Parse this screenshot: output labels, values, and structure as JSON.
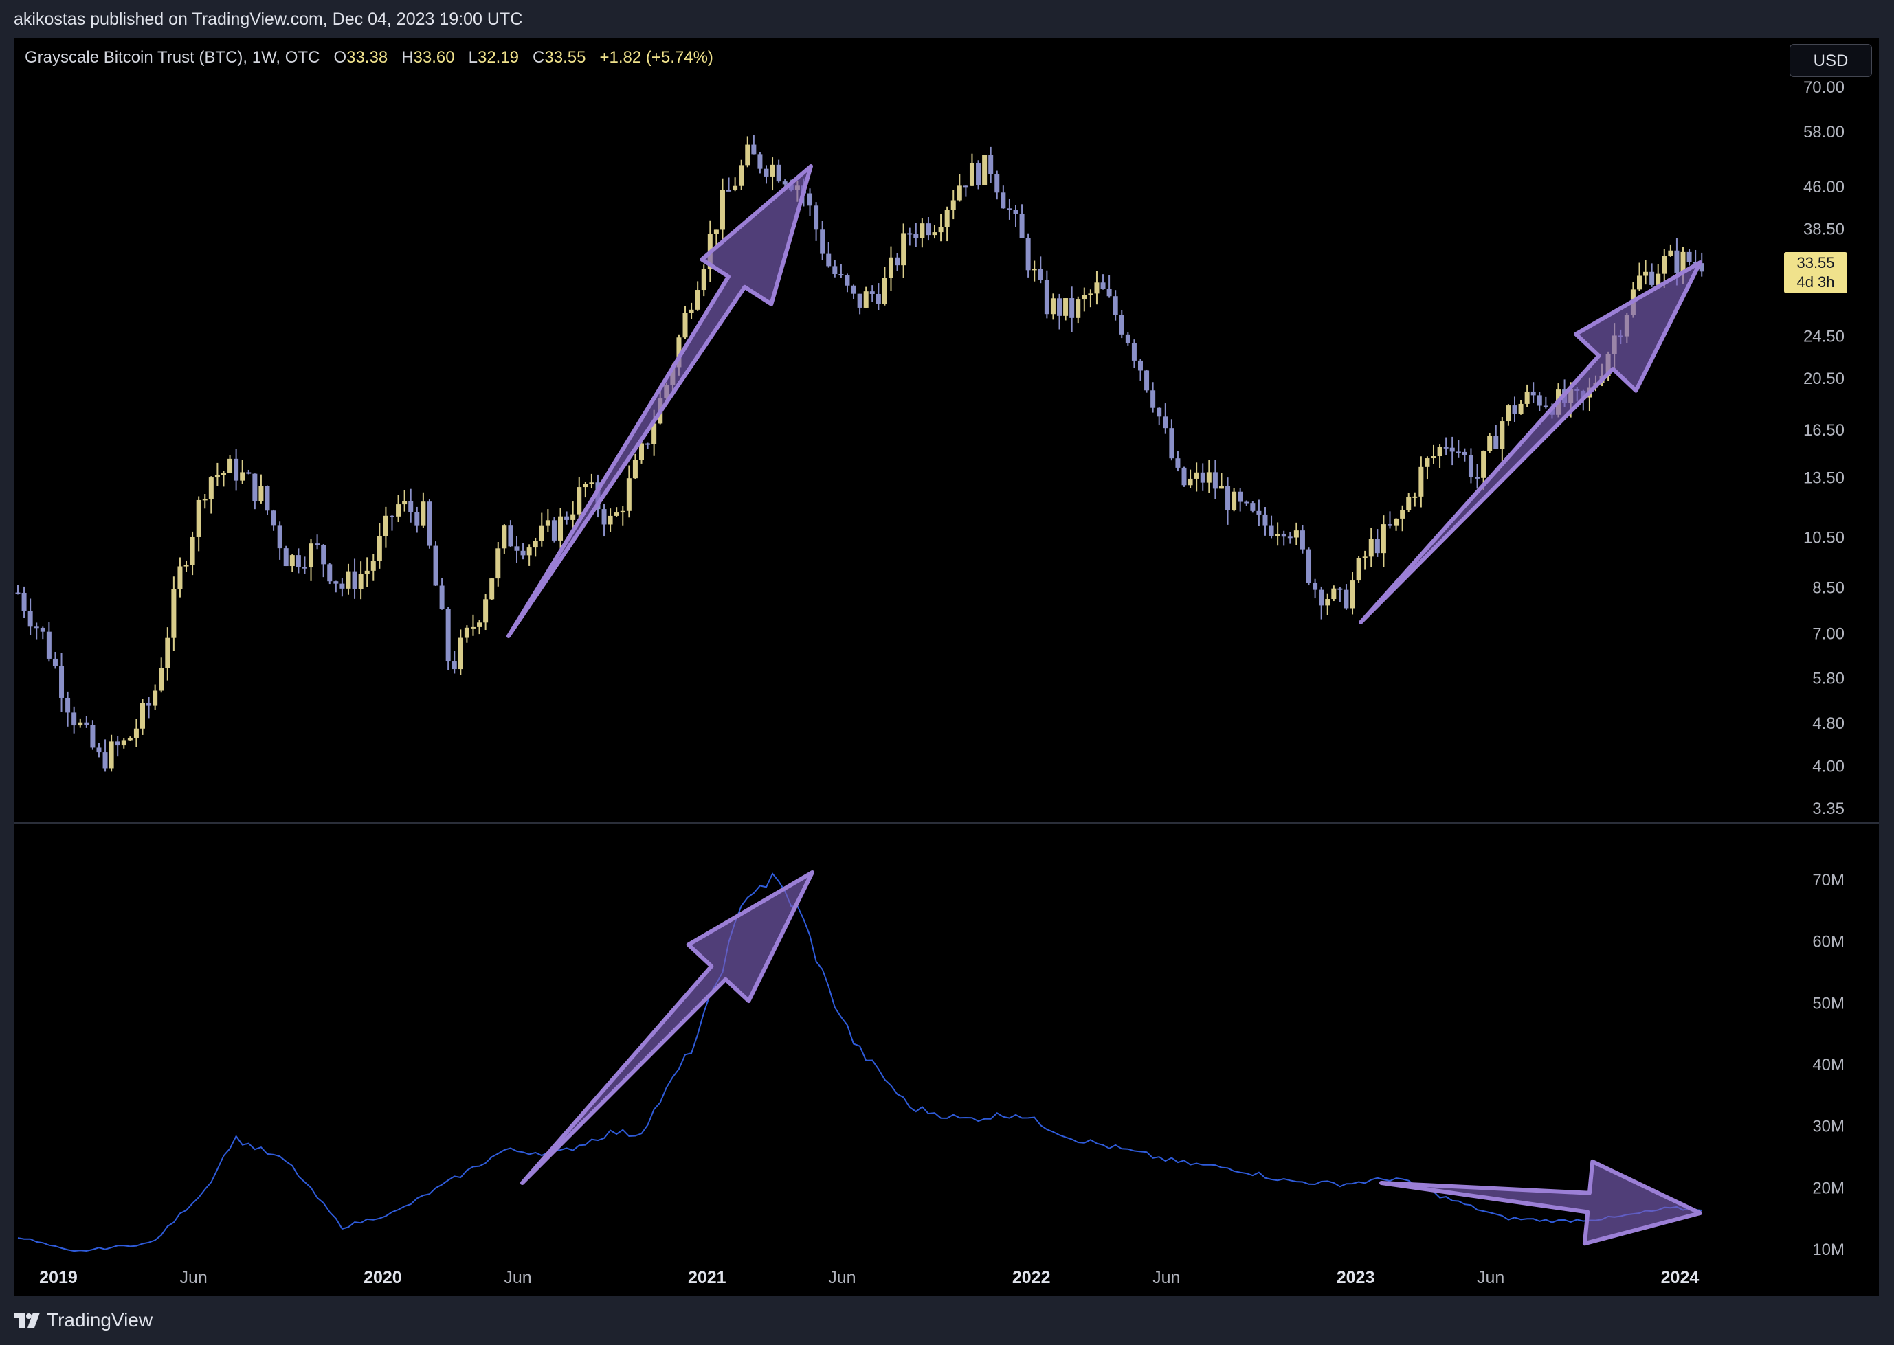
{
  "header": {
    "published": "akikostas published on TradingView.com, Dec 04, 2023 19:00 UTC"
  },
  "legend": {
    "title": "Grayscale Bitcoin Trust (BTC), 1W, OTC",
    "o_label": "O",
    "o_value": "33.38",
    "h_label": "H",
    "h_value": "33.60",
    "l_label": "L",
    "l_value": "32.19",
    "c_label": "C",
    "c_value": "33.55",
    "change": "+1.82 (+5.74%)"
  },
  "currency": "USD",
  "last_price": {
    "price": "33.55",
    "countdown": "4d 3h"
  },
  "footer": {
    "brand": "TradingView"
  },
  "colors": {
    "background": "#000000",
    "frame": "#1e222d",
    "bull_candle": "#d8cc8a",
    "bear_candle": "#8a90c8",
    "volume_line": "#2f5bd9",
    "arrow_fill": "#7b5fb8",
    "arrow_stroke": "#9b7fd6"
  },
  "chart_data": [
    {
      "type": "candlestick",
      "series_name": "Grayscale Bitcoin Trust (BTC), 1W, OTC",
      "y_scale": "log",
      "y_ticks": [
        "70.00",
        "58.00",
        "46.00",
        "38.50",
        "33.55",
        "24.50",
        "20.50",
        "16.50",
        "13.50",
        "10.50",
        "8.50",
        "7.00",
        "5.80",
        "4.80",
        "4.00",
        "3.35"
      ],
      "x_ticks": [
        "2019",
        "Jun",
        "2020",
        "Jun",
        "2021",
        "Jun",
        "2022",
        "Jun",
        "2023",
        "Jun",
        "2024"
      ],
      "approx_weekly_close_path": [
        [
          "2018-11",
          8.3
        ],
        [
          "2018-12",
          6.8
        ],
        [
          "2019-01",
          5.0
        ],
        [
          "2019-02",
          4.1
        ],
        [
          "2019-03",
          4.4
        ],
        [
          "2019-04",
          5.3
        ],
        [
          "2019-05",
          9.0
        ],
        [
          "2019-06",
          13.5
        ],
        [
          "2019-07",
          14.0
        ],
        [
          "2019-08",
          12.5
        ],
        [
          "2019-09",
          9.5
        ],
        [
          "2019-10",
          10.0
        ],
        [
          "2019-11",
          8.5
        ],
        [
          "2019-12",
          9.2
        ],
        [
          "2020-01",
          12.0
        ],
        [
          "2020-02",
          11.5
        ],
        [
          "2020-03",
          6.0
        ],
        [
          "2020-04",
          7.5
        ],
        [
          "2020-05",
          10.5
        ],
        [
          "2020-06",
          10.2
        ],
        [
          "2020-07",
          11.0
        ],
        [
          "2020-08",
          13.0
        ],
        [
          "2020-09",
          11.0
        ],
        [
          "2020-10",
          14.5
        ],
        [
          "2020-11",
          20.0
        ],
        [
          "2020-12",
          30.0
        ],
        [
          "2021-01",
          42.0
        ],
        [
          "2021-02",
          52.0
        ],
        [
          "2021-03",
          50.0
        ],
        [
          "2021-04",
          46.0
        ],
        [
          "2021-05",
          33.0
        ],
        [
          "2021-06",
          28.0
        ],
        [
          "2021-07",
          30.0
        ],
        [
          "2021-08",
          38.0
        ],
        [
          "2021-09",
          40.0
        ],
        [
          "2021-10",
          48.0
        ],
        [
          "2021-11",
          50.0
        ],
        [
          "2021-12",
          38.0
        ],
        [
          "2022-01",
          28.0
        ],
        [
          "2022-02",
          27.0
        ],
        [
          "2022-03",
          30.0
        ],
        [
          "2022-04",
          25.0
        ],
        [
          "2022-05",
          19.0
        ],
        [
          "2022-06",
          13.0
        ],
        [
          "2022-07",
          13.5
        ],
        [
          "2022-08",
          12.0
        ],
        [
          "2022-09",
          11.0
        ],
        [
          "2022-10",
          11.2
        ],
        [
          "2022-11",
          8.5
        ],
        [
          "2022-12",
          7.9
        ],
        [
          "2023-01",
          10.0
        ],
        [
          "2023-02",
          11.0
        ],
        [
          "2023-03",
          14.0
        ],
        [
          "2023-04",
          16.0
        ],
        [
          "2023-05",
          13.5
        ],
        [
          "2023-06",
          17.5
        ],
        [
          "2023-07",
          19.0
        ],
        [
          "2023-08",
          18.5
        ],
        [
          "2023-09",
          18.5
        ],
        [
          "2023-10",
          24.0
        ],
        [
          "2023-11",
          31.0
        ],
        [
          "2023-12",
          33.55
        ]
      ]
    },
    {
      "type": "line",
      "series_name": "",
      "y_ticks": [
        "70M",
        "60M",
        "50M",
        "40M",
        "30M",
        "20M",
        "10M"
      ],
      "ylim": [
        7000000,
        73000000
      ],
      "approx_path": [
        [
          "2018-11",
          12000000
        ],
        [
          "2019-01",
          9500000
        ],
        [
          "2019-04",
          11000000
        ],
        [
          "2019-06",
          20000000
        ],
        [
          "2019-07",
          28000000
        ],
        [
          "2019-09",
          24000000
        ],
        [
          "2019-11",
          13500000
        ],
        [
          "2020-01",
          16000000
        ],
        [
          "2020-03",
          21000000
        ],
        [
          "2020-05",
          26000000
        ],
        [
          "2020-07",
          25500000
        ],
        [
          "2020-09",
          29000000
        ],
        [
          "2020-10",
          28500000
        ],
        [
          "2020-12",
          43000000
        ],
        [
          "2021-01",
          55000000
        ],
        [
          "2021-02",
          68000000
        ],
        [
          "2021-03",
          70000000
        ],
        [
          "2021-04",
          64000000
        ],
        [
          "2021-05",
          52000000
        ],
        [
          "2021-06",
          43000000
        ],
        [
          "2021-08",
          33000000
        ],
        [
          "2021-10",
          31000000
        ],
        [
          "2021-12",
          32000000
        ],
        [
          "2022-02",
          28000000
        ],
        [
          "2022-04",
          26000000
        ],
        [
          "2022-06",
          24000000
        ],
        [
          "2022-08",
          23000000
        ],
        [
          "2022-10",
          21000000
        ],
        [
          "2022-12",
          20500000
        ],
        [
          "2023-02",
          21500000
        ],
        [
          "2023-04",
          18000000
        ],
        [
          "2023-06",
          15000000
        ],
        [
          "2023-08",
          14500000
        ],
        [
          "2023-10",
          15000000
        ],
        [
          "2023-12",
          16500000
        ]
      ]
    }
  ]
}
